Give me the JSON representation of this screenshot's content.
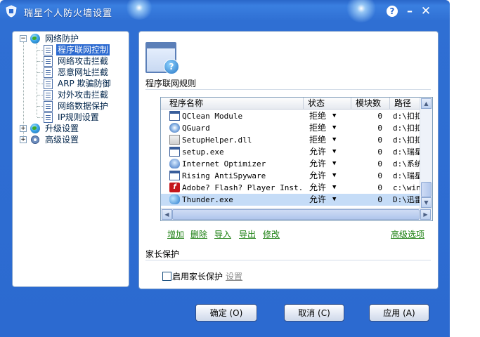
{
  "window": {
    "title": "瑞星个人防火墙设置"
  },
  "titlebar": {
    "help_symbol": "?",
    "minimize_symbol": "–",
    "close_symbol": "✕"
  },
  "tree": {
    "network": {
      "label": "网络防护",
      "items": [
        "程序联网控制",
        "网络攻击拦截",
        "恶意网址拦截",
        "ARP 欺骗防御",
        "对外攻击拦截",
        "网络数据保护",
        "IP规则设置"
      ]
    },
    "upgrade": {
      "label": "升级设置"
    },
    "advanced": {
      "label": "高级设置"
    },
    "expander_minus": "−",
    "expander_plus": "+"
  },
  "main": {
    "section_title": "程序联网规则",
    "columns": [
      "程序名称",
      "状态",
      "模块数",
      "路径"
    ],
    "rows": [
      {
        "name": "QClean Module",
        "status": "拒绝",
        "modules": "0",
        "path": "d:\\扣扣",
        "icon": "window-icon"
      },
      {
        "name": "QGuard",
        "status": "拒绝",
        "modules": "0",
        "path": "d:\\扣扣",
        "icon": "qguard-icon"
      },
      {
        "name": "SetupHelper.dll",
        "status": "拒绝",
        "modules": "0",
        "path": "d:\\扣扣",
        "icon": "dll-icon"
      },
      {
        "name": "setup.exe",
        "status": "允许",
        "modules": "0",
        "path": "d:\\瑞星",
        "icon": "window-icon"
      },
      {
        "name": "Internet Optimizer",
        "status": "允许",
        "modules": "0",
        "path": "d:\\系统",
        "icon": "optimizer-icon"
      },
      {
        "name": "Rising AntiSpyware",
        "status": "允许",
        "modules": "0",
        "path": "d:\\瑞星",
        "icon": "window-icon"
      },
      {
        "name": "Adobe? Flash? Player Inst...",
        "status": "允许",
        "modules": "0",
        "path": "c:\\win",
        "icon": "flash-icon"
      },
      {
        "name": "Thunder.exe",
        "status": "允许",
        "modules": "0",
        "path": "D:\\迅雷",
        "icon": "thunder-icon"
      }
    ],
    "selected_row": 7,
    "dropdown_arrow": "▼",
    "actions": {
      "add": "增加",
      "delete": "删除",
      "import": "导入",
      "export": "导出",
      "modify": "修改",
      "advanced_options": "高级选项"
    },
    "parental": {
      "title": "家长保护",
      "enable_label": "启用家长保护",
      "settings_link": "设置",
      "enabled": false
    }
  },
  "buttons": {
    "ok": "确定 (O)",
    "cancel": "取消 (C)",
    "apply": "应用 (A)"
  },
  "colors": {
    "titlebar": "#2c6ad0",
    "link_green": "#1b7f10",
    "selection": "#2c6ad0",
    "row_highlight": "#c5dcf7"
  }
}
